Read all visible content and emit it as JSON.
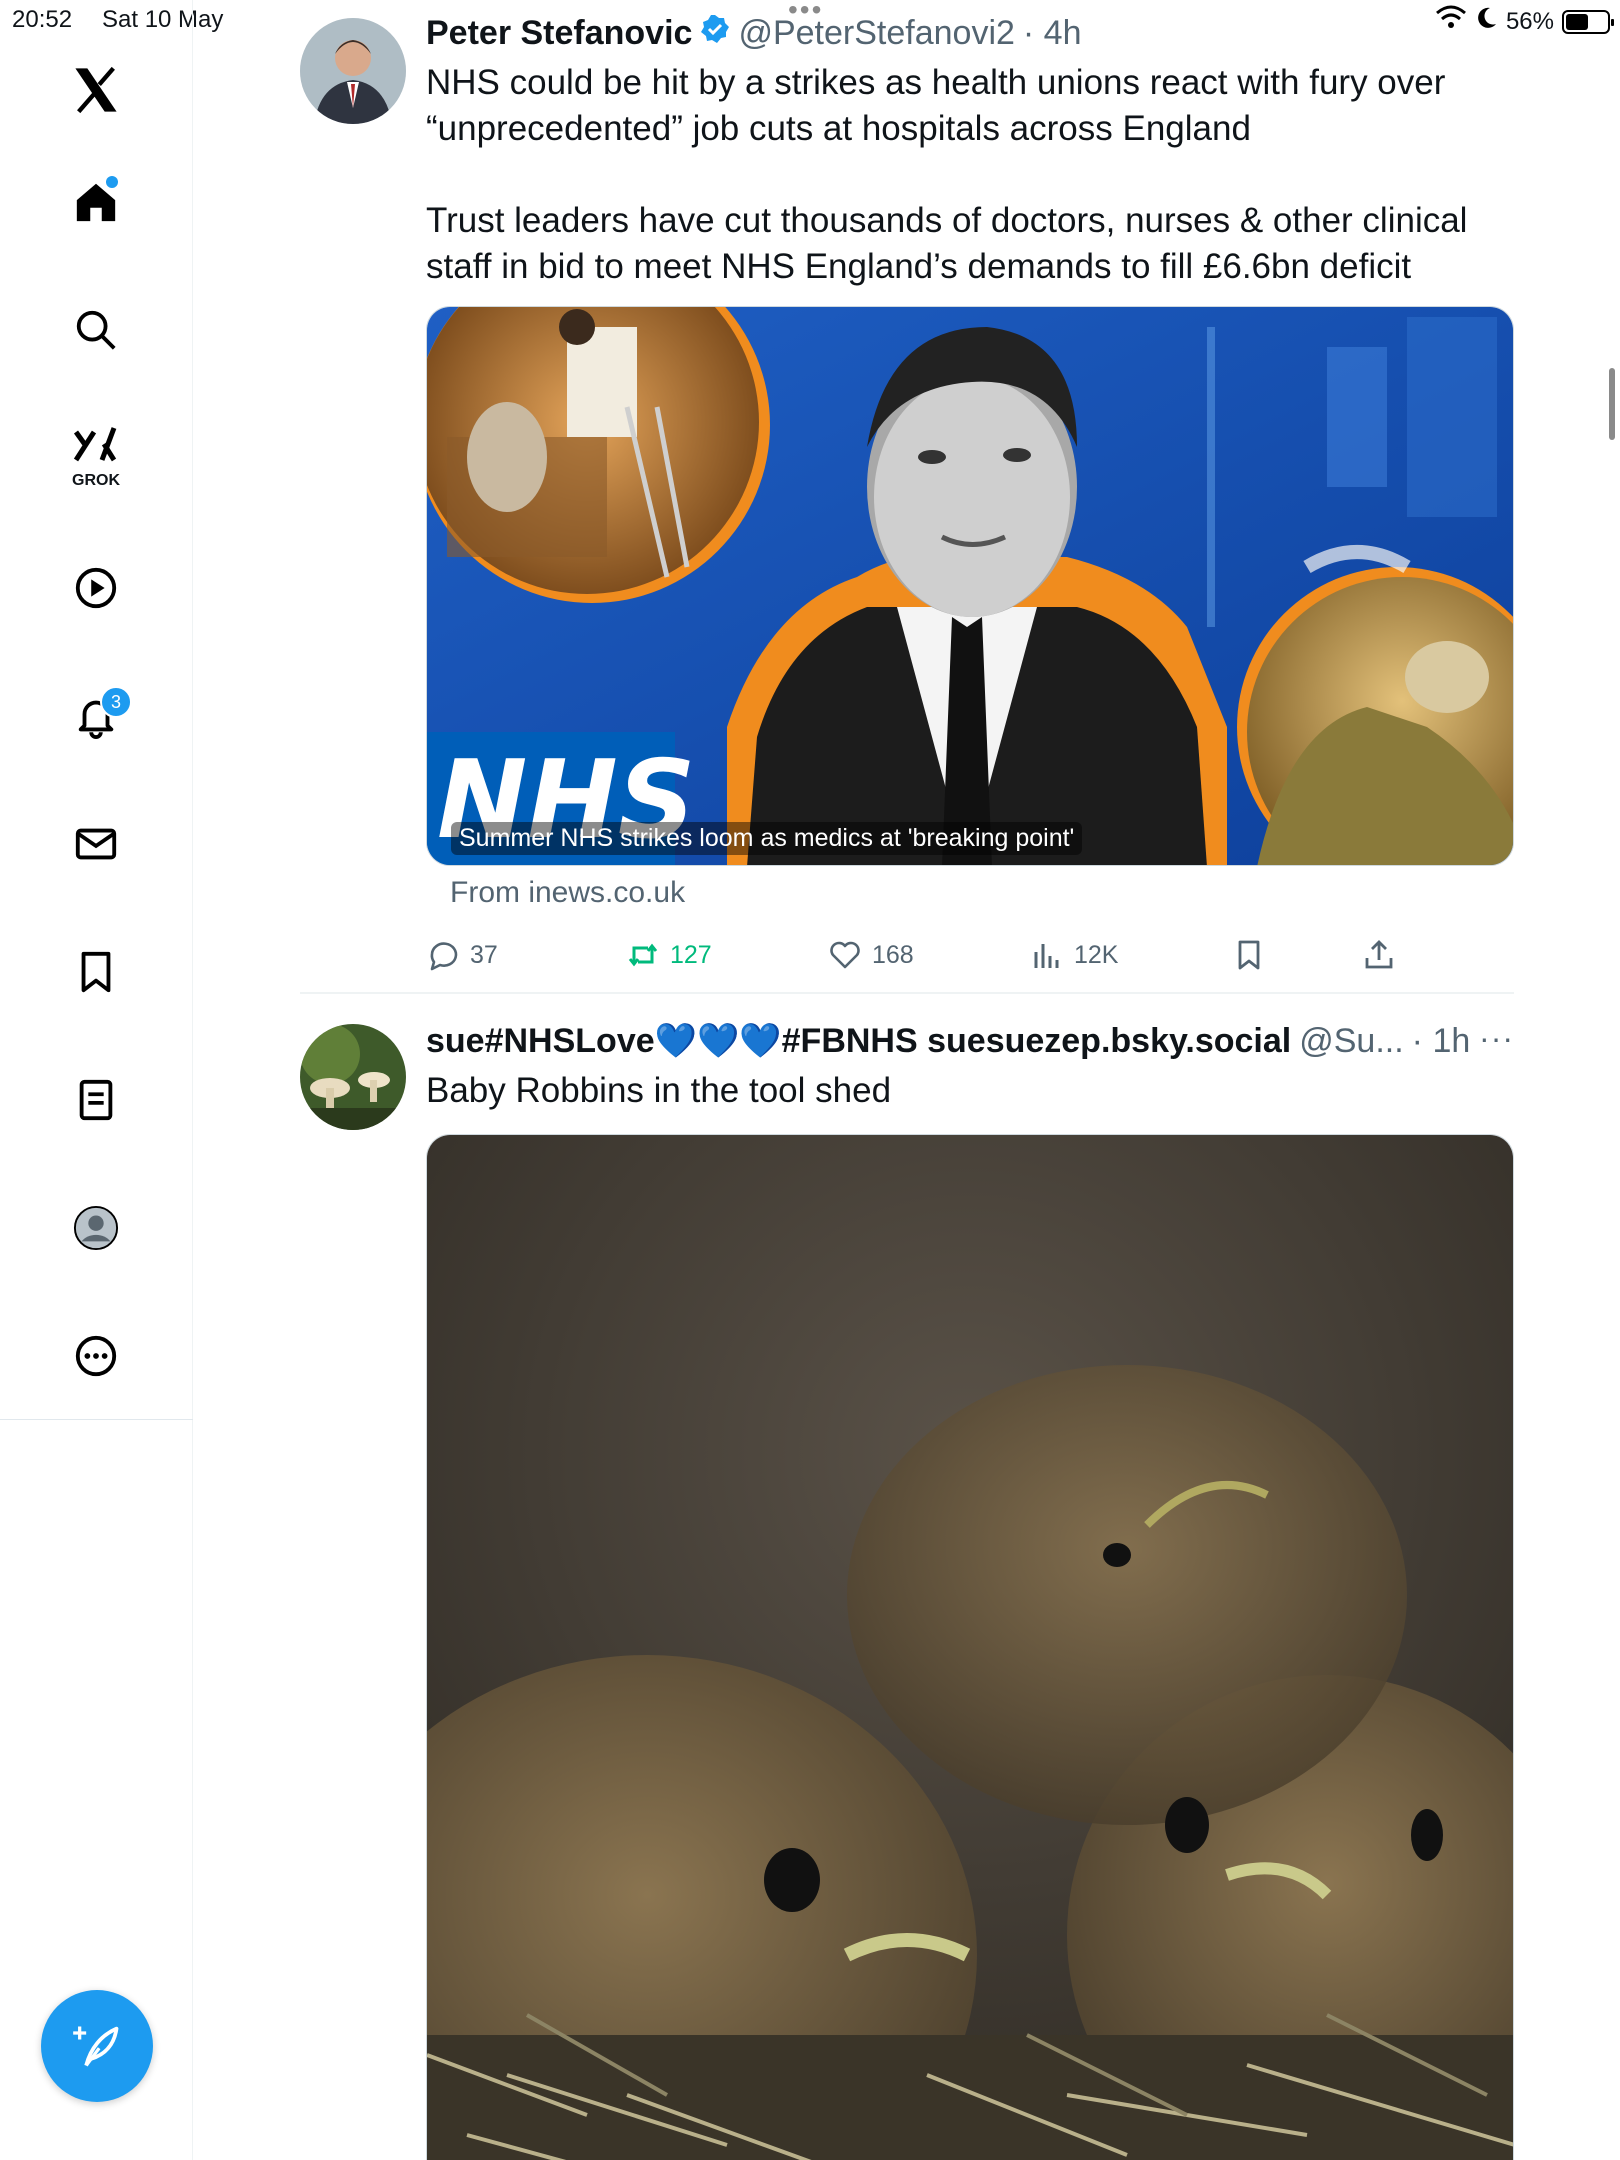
{
  "status_bar": {
    "time": "20:52",
    "date": "Sat 10 May",
    "battery_percent_label": "56%",
    "battery_level": 0.56
  },
  "sidebar": {
    "grok_label": "GROK",
    "notifications_badge": "3",
    "accent_color": "#1d9bf0"
  },
  "tweets": [
    {
      "display_name": "Peter Stefanovic",
      "verified": true,
      "handle": "@PeterStefanovi2",
      "time": "· 4h",
      "text": "NHS could be hit by a strikes as health unions react with fury over “unprecedented” job cuts at hospitals across England\n\nTrust leaders have cut thousands of doctors, nurses & other clinical staff in bid to meet NHS England’s demands to fill £6.6bn deficit",
      "card": {
        "caption": "Summer NHS strikes loom as medics at 'breaking point'",
        "source": "From inews.co.uk",
        "logo_text": "NHS"
      },
      "actions": {
        "replies": "37",
        "retweets": "127",
        "likes": "168",
        "views": "12K"
      }
    },
    {
      "display_name": "sue#NHSLove💙💙💙#FBNHS suesuezep.bsky.social",
      "handle": "@Su...",
      "time": "· 1h",
      "more": "···",
      "text": "Baby Robbins in the tool shed"
    }
  ]
}
